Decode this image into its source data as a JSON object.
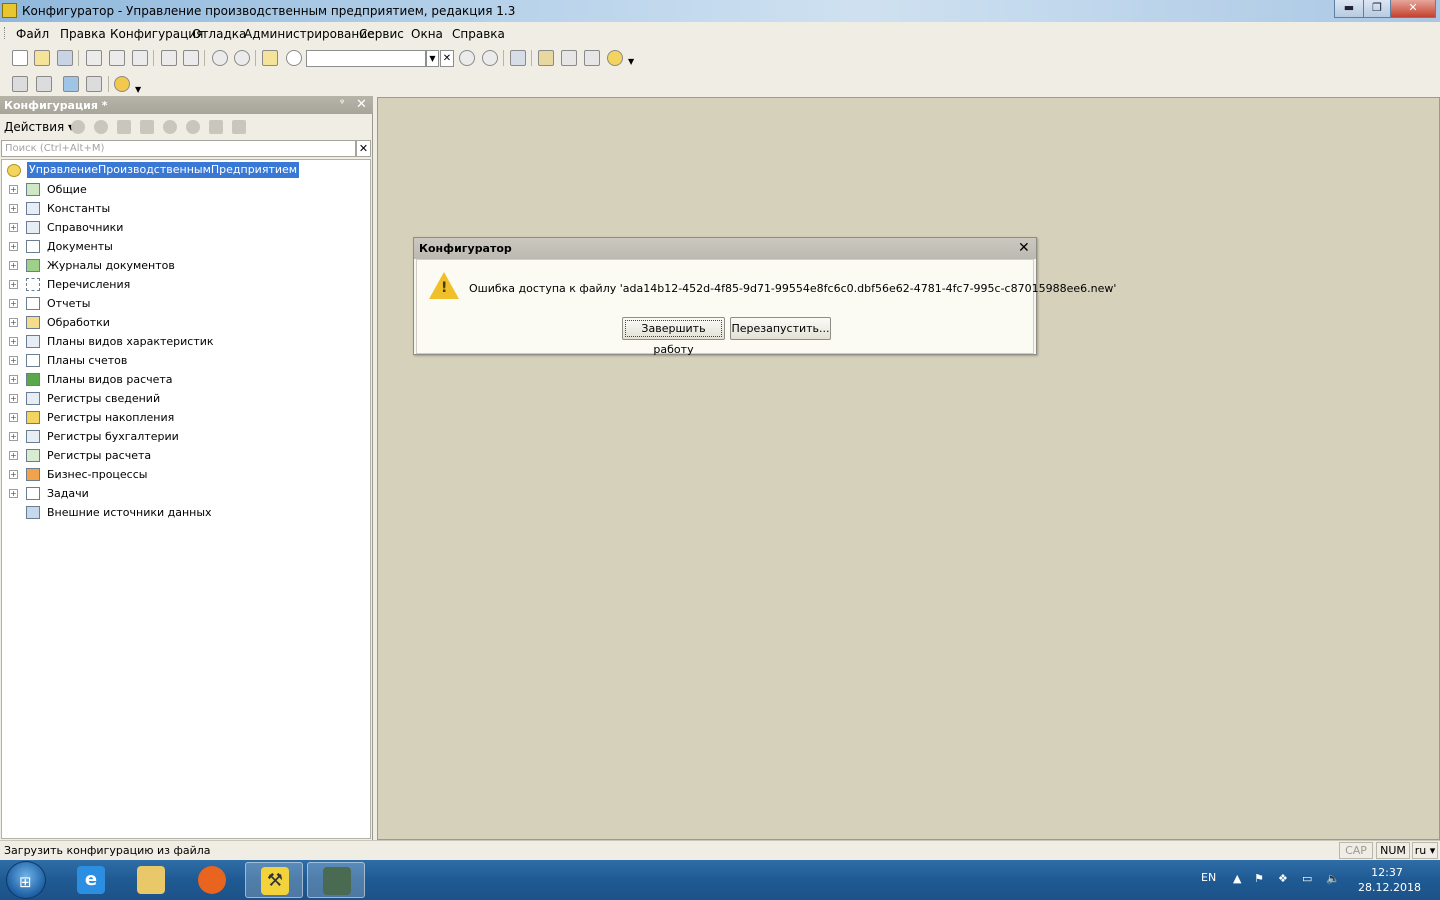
{
  "window": {
    "title": "Конфигуратор - Управление производственным предприятием, редакция 1.3",
    "minimize": "▬",
    "maximize": "❐",
    "close": "✕"
  },
  "menu": [
    "Файл",
    "Правка",
    "Конфигурация",
    "Отладка",
    "Администрирование",
    "Сервис",
    "Окна",
    "Справка"
  ],
  "toolbar": {
    "search_value": ""
  },
  "panel": {
    "title": "Конфигурация *",
    "pin": "ᵠ",
    "close": "✕",
    "actions_label": "Действия ▾",
    "search_placeholder": "Поиск (Ctrl+Alt+M)",
    "search_clear": "✕"
  },
  "tree": {
    "root": "УправлениеПроизводственнымПредприятием",
    "items": [
      "Общие",
      "Константы",
      "Справочники",
      "Документы",
      "Журналы документов",
      "Перечисления",
      "Отчеты",
      "Обработки",
      "Планы видов характеристик",
      "Планы счетов",
      "Планы видов расчета",
      "Регистры сведений",
      "Регистры накопления",
      "Регистры бухгалтерии",
      "Регистры расчета",
      "Бизнес-процессы",
      "Задачи",
      "Внешние источники данных"
    ]
  },
  "dialog": {
    "title": "Конфигуратор",
    "close": "✕",
    "message": "Ошибка доступа к файлу 'ada14b12-452d-4f85-9d71-99554e8fc6c0.dbf56e62-4781-4fc7-995c-c87015988ee6.new'",
    "btn_finish": "Завершить работу",
    "btn_restart": "Перезапустить..."
  },
  "statusbar": {
    "text": "Загрузить конфигурацию из файла",
    "cap": "CAP",
    "num": "NUM",
    "lang": "ru ▾"
  },
  "taskbar": {
    "lang": "EN",
    "time": "12:37",
    "date": "28.12.2018"
  }
}
